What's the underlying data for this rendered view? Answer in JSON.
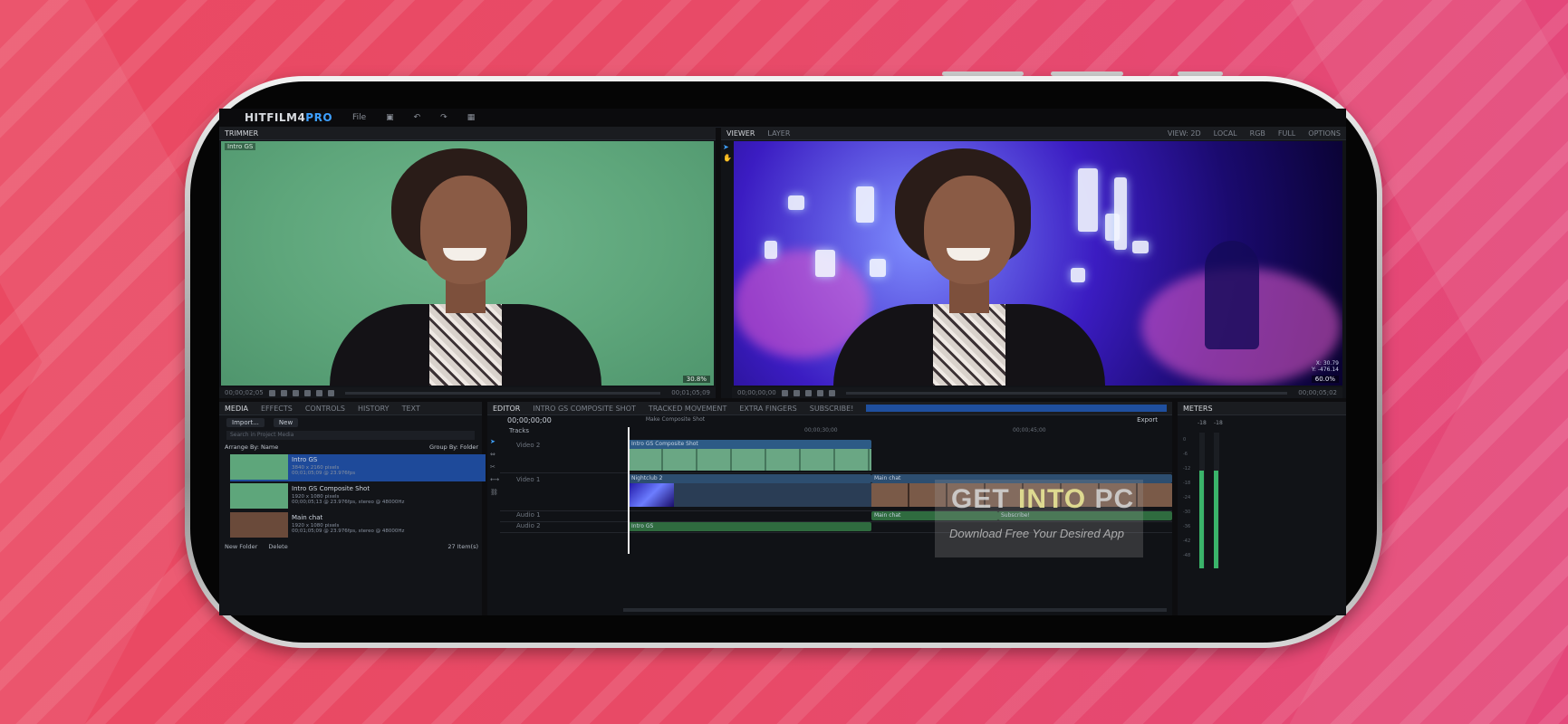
{
  "app": {
    "logo_main": "HITFILM4",
    "logo_accent": "PRO",
    "menu": [
      "File"
    ]
  },
  "trimmer": {
    "tab": "TRIMMER",
    "clip_name": "Intro GS",
    "zoom": "30.8%",
    "timecode_start": "00;00;02;05",
    "timecode_end": "00;01;05;09"
  },
  "viewer": {
    "tabs": [
      "VIEWER",
      "LAYER"
    ],
    "options": [
      "VIEW: 2D",
      "LOCAL",
      "RGB",
      "FULL",
      "OPTIONS"
    ],
    "zoom": "60.0%",
    "coords": [
      "X: 30.79",
      "Y: -476.14"
    ],
    "timecode_start": "00;00;00;00",
    "timecode_end": "00;00;05;02"
  },
  "media": {
    "tabs": [
      "MEDIA",
      "EFFECTS",
      "CONTROLS",
      "HISTORY",
      "TEXT"
    ],
    "import_label": "Import...",
    "new_label": "New",
    "search_placeholder": "Search in Project Media",
    "arrange_label": "Arrange By: Name",
    "group_label": "Group By: Folder",
    "items": [
      {
        "title": "Intro GS",
        "sub1": "3840 x 2160 pixels",
        "sub2": "00;01;05;09 @ 23.976fps"
      },
      {
        "title": "Intro GS Composite Shot",
        "sub1": "1920 x 1080 pixels",
        "sub2": "00;00;05;13 @ 23.976fps, stereo @ 48000Hz"
      },
      {
        "title": "Main chat",
        "sub1": "1920 x 1080 pixels",
        "sub2": "00;01;05;09 @ 23.976fps, stereo @ 48000Hz"
      }
    ],
    "folder_label": "New Folder",
    "delete_label": "Delete",
    "count_label": "27 Item(s)"
  },
  "editor": {
    "tabs": [
      "EDITOR",
      "INTRO GS COMPOSITE SHOT",
      "TRACKED MOVEMENT",
      "EXTRA FINGERS",
      "SUBSCRIBE!"
    ],
    "timecode": "00;00;00;00",
    "make_composite": "Make Composite Shot",
    "export_label": "Export",
    "tracks_label": "Tracks",
    "ruler": [
      "00;00;30;00",
      "00;00;45;00"
    ],
    "tracks": [
      {
        "name": "Video 2"
      },
      {
        "name": "Video 1"
      },
      {
        "name": "Audio 1"
      },
      {
        "name": "Audio 2"
      }
    ],
    "clips": {
      "v2": "Intro GS Composite Shot",
      "v1a": "Nightclub 2",
      "v1b": "Main chat",
      "a1a": "Main chat",
      "a1b": "Subscribe!",
      "a2": "Intro GS"
    }
  },
  "meters": {
    "tab": "METERS",
    "labels": [
      "-18",
      "-18"
    ],
    "scale": [
      "0",
      "-6",
      "-12",
      "-18",
      "-24",
      "-30",
      "-36",
      "-42",
      "-48"
    ],
    "level_left": 0.72,
    "level_right": 0.72
  },
  "watermark": {
    "word1": "GET",
    "word2": "INTO",
    "word3": "PC",
    "tagline": "Download Free Your Desired App"
  }
}
